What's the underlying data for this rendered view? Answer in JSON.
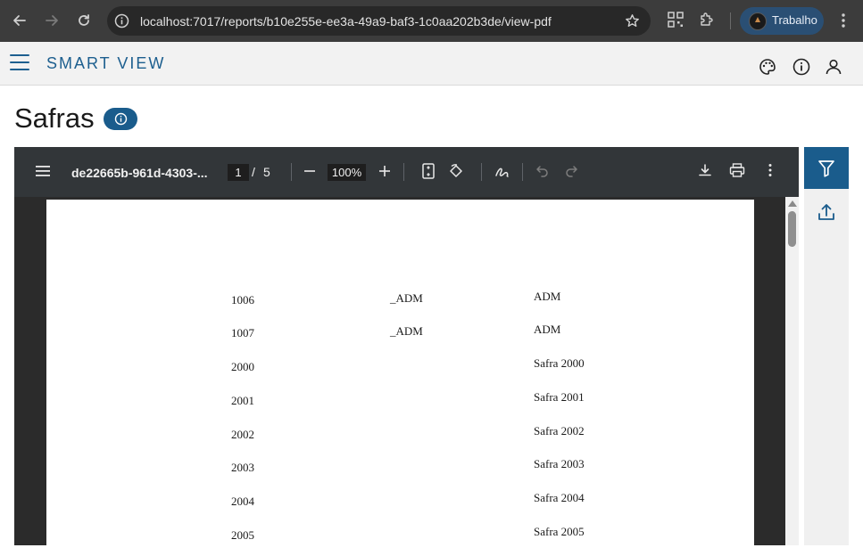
{
  "browser": {
    "url": "localhost:7017/reports/b10e255e-ee3a-49a9-baf3-1c0aa202b3de/view-pdf",
    "profile_name": "Trabalho"
  },
  "app": {
    "brand": "SMART VIEW"
  },
  "page": {
    "title": "Safras"
  },
  "pdf_viewer": {
    "file_name": "de22665b-961d-4303-...",
    "current_page": "1",
    "page_separator": "/",
    "total_pages": "5",
    "zoom": "100%"
  },
  "pdf_rows": [
    {
      "code": "1006",
      "group": "_ADM",
      "name": "ADM"
    },
    {
      "code": "1007",
      "group": "_ADM",
      "name": "ADM"
    },
    {
      "code": "2000",
      "group": "",
      "name": "Safra 2000"
    },
    {
      "code": "2001",
      "group": "",
      "name": "Safra 2001"
    },
    {
      "code": "2002",
      "group": "",
      "name": "Safra 2002"
    },
    {
      "code": "2003",
      "group": "",
      "name": "Safra 2003"
    },
    {
      "code": "2004",
      "group": "",
      "name": "Safra 2004"
    },
    {
      "code": "2005",
      "group": "",
      "name": "Safra 2005"
    }
  ],
  "colors": {
    "brand": "#1d5f8f",
    "accent": "#1a5c8c",
    "pdf_toolbar": "#323639"
  }
}
